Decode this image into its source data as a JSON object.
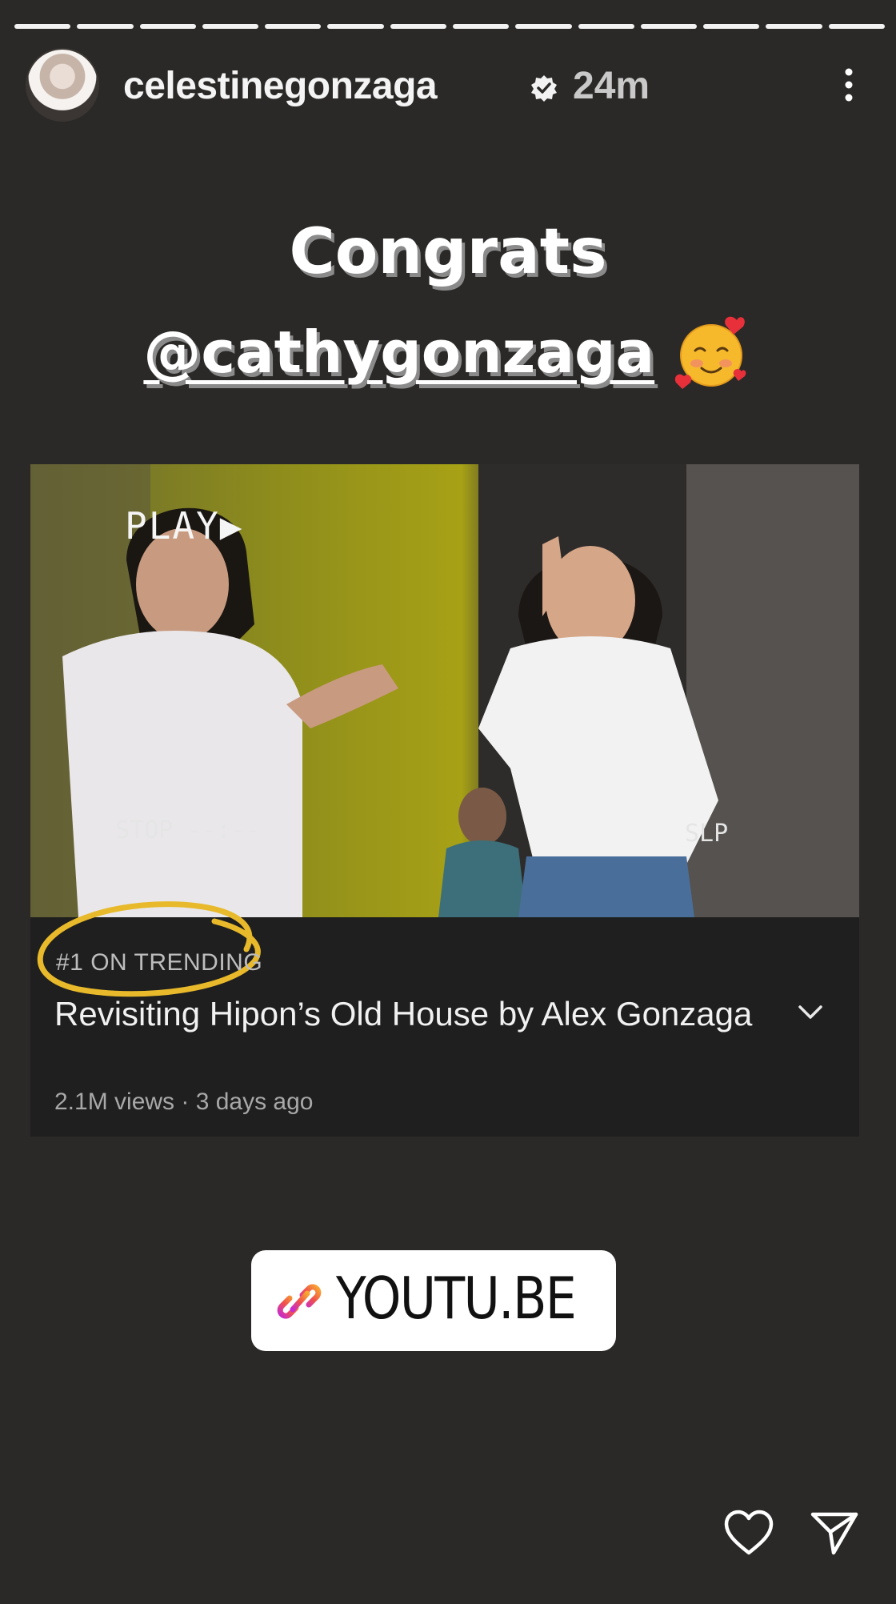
{
  "story": {
    "progress_segments": 14,
    "username": "celestinegonzaga",
    "time_ago": "24m"
  },
  "caption": {
    "line1": "Congrats",
    "mention": "@cathygonzaga"
  },
  "video_card": {
    "overlay_play": "PLAY▶",
    "overlay_stop": "STOP  --:--",
    "overlay_slp": "SLP",
    "trending": "#1 ON TRENDING",
    "title": "Revisiting Hipon’s Old House by Alex Gonzaga",
    "meta": "2.1M views · 3 days ago"
  },
  "link_sticker": {
    "label": "YOUTU.BE"
  },
  "colors": {
    "background": "#2b2927",
    "card": "#1f1f1f",
    "highlight_circle": "#e8b92a"
  },
  "icons": [
    "verified-badge-icon",
    "more-options-icon",
    "smiling-hearts-emoji",
    "chevron-down-icon",
    "link-icon",
    "heart-icon",
    "send-icon"
  ]
}
